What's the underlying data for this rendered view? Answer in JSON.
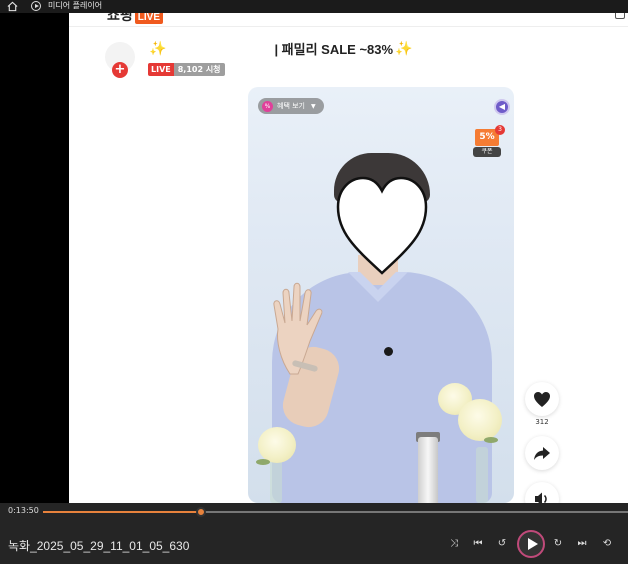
{
  "window": {
    "title": "미디어 플레이어"
  },
  "site": {
    "logo_text": "쇼핑",
    "logo_badge": "LIVE"
  },
  "stream": {
    "title": "| 패밀리 SALE ~83%",
    "live_label": "LIVE",
    "viewer_count": "8,102 시청",
    "follow_symbol": "+"
  },
  "overlay": {
    "benefit_label": "혜택 보기",
    "benefit_icon_text": "%",
    "coupon_percent": "5%",
    "coupon_count": "3",
    "coupon_label": "쿠폰"
  },
  "actions": {
    "like_count": "312"
  },
  "player": {
    "time_current": "0:13:50",
    "progress_fraction": 0.27,
    "filename": "녹화_2025_05_29_11_01_05_630"
  },
  "colors": {
    "accent": "#e8823c",
    "live_red": "#e53935",
    "coupon_orange": "#f57c33"
  }
}
